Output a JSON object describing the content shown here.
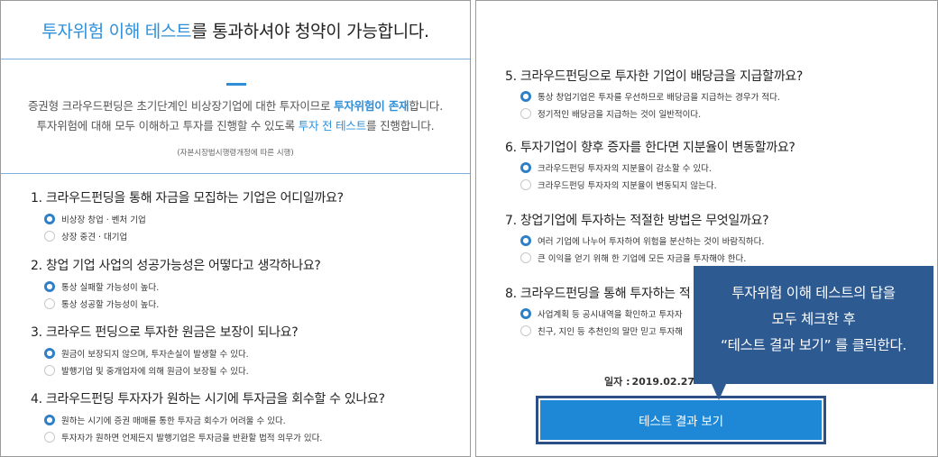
{
  "left": {
    "header": {
      "title_blue": "투자위험 이해 테스트",
      "title_rest": "를 통과하셔야 청약이 가능합니다."
    },
    "intro": {
      "l1_a": "증권형 크라우드펀딩은 초기단계인 비상장기업에 대한 투자이므로 ",
      "l1_b": "투자위험이 존재",
      "l1_c": "합니다.",
      "l2_a": "투자위험에 대해 모두 이해하고 투자를 진행할 수 있도록 ",
      "l2_b": "투자 전 테스트",
      "l2_c": "를 진행합니다.",
      "note": "(자본시장법시행령개정에 따른 시행)"
    },
    "questions": [
      {
        "title": "1. 크라우드펀딩을 통해 자금을 모집하는 기업은 어디일까요?",
        "options": [
          {
            "label": "비상장 창업 · 벤처 기업",
            "selected": true
          },
          {
            "label": "상장 중견 · 대기업",
            "selected": false
          }
        ]
      },
      {
        "title": "2. 창업 기업 사업의 성공가능성은 어떻다고 생각하나요?",
        "options": [
          {
            "label": "통상 실패할 가능성이 높다.",
            "selected": true
          },
          {
            "label": "통상 성공할 가능성이 높다.",
            "selected": false
          }
        ]
      },
      {
        "title": "3. 크라우드 펀딩으로 투자한 원금은 보장이 되나요?",
        "options": [
          {
            "label": "원금이 보장되지 않으며, 투자손실이 발생할 수 있다.",
            "selected": true
          },
          {
            "label": "발행기업 및 중개업자에 의해 원금이 보장될 수 있다.",
            "selected": false
          }
        ]
      },
      {
        "title": "4. 크라우드펀딩 투자자가 원하는 시기에 투자금을 회수할 수 있나요?",
        "options": [
          {
            "label": "원하는 시기에 증권 매매를 통한 투자금 회수가 어려울 수 있다.",
            "selected": true
          },
          {
            "label": "투자자가 원하면 언제든지 발행기업은 투자금을 반환할 법적 의무가 있다.",
            "selected": false
          }
        ]
      }
    ]
  },
  "right": {
    "questions": [
      {
        "title": "5. 크라우드펀딩으로 투자한 기업이 배당금을 지급할까요?",
        "options": [
          {
            "label": "통상 창업기업은 투자를 우선하므로 배당금을 지급하는 경우가 적다.",
            "selected": true
          },
          {
            "label": "정기적인 배당금을 지급하는 것이 일반적이다.",
            "selected": false
          }
        ]
      },
      {
        "title": "6. 투자기업이 향후 증자를 한다면 지분율이 변동할까요?",
        "options": [
          {
            "label": "크라우드펀딩 투자자의 지분율이 감소할 수 있다.",
            "selected": true
          },
          {
            "label": "크라우드펀딩 투자자의 지분율이 변동되지 않는다.",
            "selected": false
          }
        ]
      },
      {
        "title": "7. 창업기업에 투자하는 적절한 방법은 무엇일까요?",
        "options": [
          {
            "label": "여러 기업에 나누어 투자하여 위험을 분산하는 것이 바람직하다.",
            "selected": true
          },
          {
            "label": "큰 이익을 얻기 위해 한 기업에 모든 자금을 투자해야 한다.",
            "selected": false
          }
        ]
      },
      {
        "title": "8. 크라우드펀딩을 통해 투자하는 적",
        "options": [
          {
            "label": "사업계획 등 공시내역을 확인하고 투자자",
            "selected": true
          },
          {
            "label": "친구, 지인 등 추천인의 말만 믿고 투자해",
            "selected": false
          }
        ]
      }
    ],
    "date_label": "일자 :",
    "date_value": "2019.02.27",
    "result_button": "테스트 결과 보기"
  },
  "callout": {
    "line1": "투자위험 이해 테스트의 답을",
    "line2": "모두 체크한 후",
    "line3": "“테스트 결과 보기” 를 클릭한다."
  }
}
